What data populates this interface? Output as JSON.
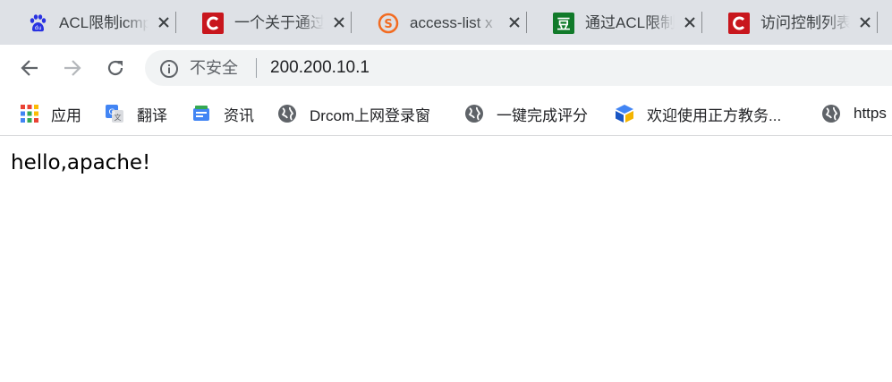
{
  "tabs": [
    {
      "title": "ACL限制icmp",
      "favicon": "baidu-paw-icon"
    },
    {
      "title": "一个关于通过",
      "favicon": "csdn-c-icon"
    },
    {
      "title": "access-list x",
      "favicon": "sogou-s-icon"
    },
    {
      "title": "通过ACL限制",
      "favicon": "douban-dou-icon"
    },
    {
      "title": "访问控制列表",
      "favicon": "csdn-c-icon"
    }
  ],
  "omnibox": {
    "security_label": "不安全",
    "url": "200.200.10.1"
  },
  "bookmarks": [
    {
      "label": "应用",
      "icon": "apps-grid-icon"
    },
    {
      "label": "翻译",
      "icon": "google-translate-icon"
    },
    {
      "label": "资讯",
      "icon": "news-icon"
    },
    {
      "label": "Drcom上网登录窗",
      "icon": "globe-icon"
    },
    {
      "label": "一键完成评分",
      "icon": "globe-icon"
    },
    {
      "label": "欢迎使用正方教务...",
      "icon": "zhengfang-icon"
    },
    {
      "label": "https",
      "icon": "globe-icon"
    }
  ],
  "page": {
    "body_text": "hello,apache!"
  },
  "colors": {
    "tabstrip_bg": "#dee1e6",
    "omnibox_bg": "#f1f3f4",
    "csdn_red": "#c8161d",
    "douban_green": "#117a2a",
    "sogou_orange": "#f26b21",
    "baidu_blue": "#2932e1"
  }
}
